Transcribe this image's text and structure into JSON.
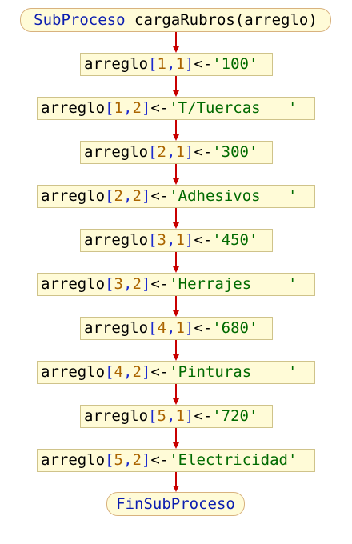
{
  "diagram": {
    "start": {
      "keyword": "SubProceso",
      "name": "cargaRubros",
      "params": "(arreglo)"
    },
    "end": {
      "keyword": "FinSubProceso"
    },
    "statements": [
      {
        "var": "arreglo",
        "i": "1",
        "j": "1",
        "op": "<-",
        "value": "'100'"
      },
      {
        "var": "arreglo",
        "i": "1",
        "j": "2",
        "op": "<-",
        "value": "'T/Tuercas   '"
      },
      {
        "var": "arreglo",
        "i": "2",
        "j": "1",
        "op": "<-",
        "value": "'300'"
      },
      {
        "var": "arreglo",
        "i": "2",
        "j": "2",
        "op": "<-",
        "value": "'Adhesivos   '"
      },
      {
        "var": "arreglo",
        "i": "3",
        "j": "1",
        "op": "<-",
        "value": "'450'"
      },
      {
        "var": "arreglo",
        "i": "3",
        "j": "2",
        "op": "<-",
        "value": "'Herrajes    '"
      },
      {
        "var": "arreglo",
        "i": "4",
        "j": "1",
        "op": "<-",
        "value": "'680'"
      },
      {
        "var": "arreglo",
        "i": "4",
        "j": "2",
        "op": "<-",
        "value": "'Pinturas    '"
      },
      {
        "var": "arreglo",
        "i": "5",
        "j": "1",
        "op": "<-",
        "value": "'720'"
      },
      {
        "var": "arreglo",
        "i": "5",
        "j": "2",
        "op": "<-",
        "value": "'Electricidad'"
      }
    ],
    "colors": {
      "box_fill": "#fffbd7",
      "box_border": "#cfc38a",
      "arrow": "#c80000",
      "keyword": "#0b1db0",
      "number": "#aa6400",
      "string": "#006a00"
    }
  }
}
